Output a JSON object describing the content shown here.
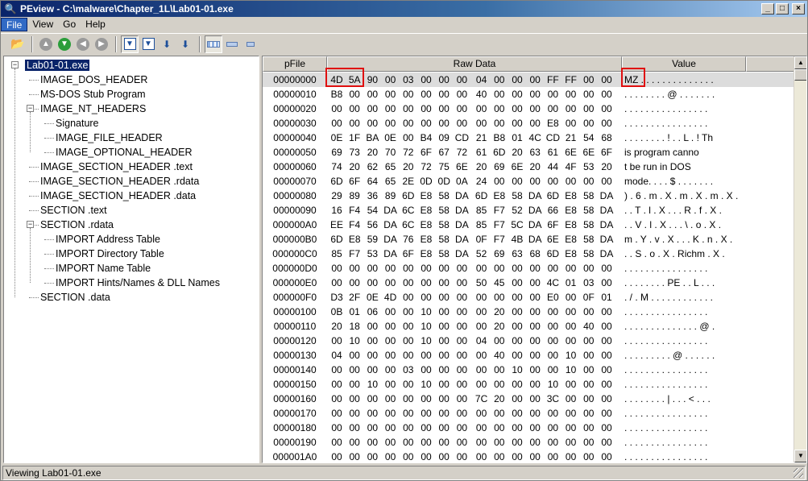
{
  "window": {
    "title": "PEview - C:\\malware\\Chapter_1L\\Lab01-01.exe",
    "app_icon": "magnifier-icon",
    "buttons": {
      "minimize": "_",
      "maximize": "□",
      "close": "×"
    }
  },
  "menu": [
    "File",
    "View",
    "Go",
    "Help"
  ],
  "toolbar": [
    "open-icon",
    "back-gray-icon",
    "forward-green-icon",
    "back-icon",
    "forward-icon",
    "header-icon",
    "section-icon",
    "prev-icon",
    "next-icon",
    "hex-view-icon",
    "dword-view-icon",
    "word-view-icon"
  ],
  "tree": [
    {
      "label": "Lab01-01.exe",
      "level": 0,
      "expander": "−",
      "selected": true
    },
    {
      "label": "IMAGE_DOS_HEADER",
      "level": 1
    },
    {
      "label": "MS-DOS Stub Program",
      "level": 1
    },
    {
      "label": "IMAGE_NT_HEADERS",
      "level": 1,
      "expander": "−"
    },
    {
      "label": "Signature",
      "level": 2
    },
    {
      "label": "IMAGE_FILE_HEADER",
      "level": 2
    },
    {
      "label": "IMAGE_OPTIONAL_HEADER",
      "level": 2
    },
    {
      "label": "IMAGE_SECTION_HEADER .text",
      "level": 1
    },
    {
      "label": "IMAGE_SECTION_HEADER .rdata",
      "level": 1
    },
    {
      "label": "IMAGE_SECTION_HEADER .data",
      "level": 1
    },
    {
      "label": "SECTION .text",
      "level": 1
    },
    {
      "label": "SECTION .rdata",
      "level": 1,
      "expander": "−"
    },
    {
      "label": "IMPORT Address Table",
      "level": 2
    },
    {
      "label": "IMPORT Directory Table",
      "level": 2
    },
    {
      "label": "IMPORT Name Table",
      "level": 2
    },
    {
      "label": "IMPORT Hints/Names & DLL Names",
      "level": 2
    },
    {
      "label": "SECTION .data",
      "level": 1
    }
  ],
  "hex": {
    "headers": {
      "offset": "pFile",
      "raw": "Raw Data",
      "value": "Value"
    },
    "rows": [
      {
        "off": "00000000",
        "bytes": [
          "4D",
          "5A",
          "90",
          "00",
          "03",
          "00",
          "00",
          "00",
          "04",
          "00",
          "00",
          "00",
          "FF",
          "FF",
          "00",
          "00"
        ],
        "val": "MZ . . . . . . . . . . . . . ."
      },
      {
        "off": "00000010",
        "bytes": [
          "B8",
          "00",
          "00",
          "00",
          "00",
          "00",
          "00",
          "00",
          "40",
          "00",
          "00",
          "00",
          "00",
          "00",
          "00",
          "00"
        ],
        "val": ". . . . . . . . @ . . . . . . ."
      },
      {
        "off": "00000020",
        "bytes": [
          "00",
          "00",
          "00",
          "00",
          "00",
          "00",
          "00",
          "00",
          "00",
          "00",
          "00",
          "00",
          "00",
          "00",
          "00",
          "00"
        ],
        "val": ". . . . . . . . . . . . . . . ."
      },
      {
        "off": "00000030",
        "bytes": [
          "00",
          "00",
          "00",
          "00",
          "00",
          "00",
          "00",
          "00",
          "00",
          "00",
          "00",
          "00",
          "E8",
          "00",
          "00",
          "00"
        ],
        "val": ". . . . . . . . . . . . . . . ."
      },
      {
        "off": "00000040",
        "bytes": [
          "0E",
          "1F",
          "BA",
          "0E",
          "00",
          "B4",
          "09",
          "CD",
          "21",
          "B8",
          "01",
          "4C",
          "CD",
          "21",
          "54",
          "68"
        ],
        "val": ". . . . . . . . ! . . L . ! Th"
      },
      {
        "off": "00000050",
        "bytes": [
          "69",
          "73",
          "20",
          "70",
          "72",
          "6F",
          "67",
          "72",
          "61",
          "6D",
          "20",
          "63",
          "61",
          "6E",
          "6E",
          "6F"
        ],
        "val": "is program canno"
      },
      {
        "off": "00000060",
        "bytes": [
          "74",
          "20",
          "62",
          "65",
          "20",
          "72",
          "75",
          "6E",
          "20",
          "69",
          "6E",
          "20",
          "44",
          "4F",
          "53",
          "20"
        ],
        "val": "t be run in DOS"
      },
      {
        "off": "00000070",
        "bytes": [
          "6D",
          "6F",
          "64",
          "65",
          "2E",
          "0D",
          "0D",
          "0A",
          "24",
          "00",
          "00",
          "00",
          "00",
          "00",
          "00",
          "00"
        ],
        "val": "mode. . . . $ . . . . . . ."
      },
      {
        "off": "00000080",
        "bytes": [
          "29",
          "89",
          "36",
          "89",
          "6D",
          "E8",
          "58",
          "DA",
          "6D",
          "E8",
          "58",
          "DA",
          "6D",
          "E8",
          "58",
          "DA"
        ],
        "val": ") . 6 . m . X . m . X . m . X ."
      },
      {
        "off": "00000090",
        "bytes": [
          "16",
          "F4",
          "54",
          "DA",
          "6C",
          "E8",
          "58",
          "DA",
          "85",
          "F7",
          "52",
          "DA",
          "66",
          "E8",
          "58",
          "DA"
        ],
        "val": ". . T . l . X . . . R . f . X ."
      },
      {
        "off": "000000A0",
        "bytes": [
          "EE",
          "F4",
          "56",
          "DA",
          "6C",
          "E8",
          "58",
          "DA",
          "85",
          "F7",
          "5C",
          "DA",
          "6F",
          "E8",
          "58",
          "DA"
        ],
        "val": ". . V . l . X . . . \\ . o . X ."
      },
      {
        "off": "000000B0",
        "bytes": [
          "6D",
          "E8",
          "59",
          "DA",
          "76",
          "E8",
          "58",
          "DA",
          "0F",
          "F7",
          "4B",
          "DA",
          "6E",
          "E8",
          "58",
          "DA"
        ],
        "val": "m . Y . v . X . . . K . n . X ."
      },
      {
        "off": "000000C0",
        "bytes": [
          "85",
          "F7",
          "53",
          "DA",
          "6F",
          "E8",
          "58",
          "DA",
          "52",
          "69",
          "63",
          "68",
          "6D",
          "E8",
          "58",
          "DA"
        ],
        "val": ". . S . o . X . Richm . X ."
      },
      {
        "off": "000000D0",
        "bytes": [
          "00",
          "00",
          "00",
          "00",
          "00",
          "00",
          "00",
          "00",
          "00",
          "00",
          "00",
          "00",
          "00",
          "00",
          "00",
          "00"
        ],
        "val": ". . . . . . . . . . . . . . . ."
      },
      {
        "off": "000000E0",
        "bytes": [
          "00",
          "00",
          "00",
          "00",
          "00",
          "00",
          "00",
          "00",
          "50",
          "45",
          "00",
          "00",
          "4C",
          "01",
          "03",
          "00"
        ],
        "val": ". . . . . . . . PE . . L . . ."
      },
      {
        "off": "000000F0",
        "bytes": [
          "D3",
          "2F",
          "0E",
          "4D",
          "00",
          "00",
          "00",
          "00",
          "00",
          "00",
          "00",
          "00",
          "E0",
          "00",
          "0F",
          "01"
        ],
        "val": ". / . M . . . . . . . . . . . ."
      },
      {
        "off": "00000100",
        "bytes": [
          "0B",
          "01",
          "06",
          "00",
          "00",
          "10",
          "00",
          "00",
          "00",
          "20",
          "00",
          "00",
          "00",
          "00",
          "00",
          "00"
        ],
        "val": ". . . . . . . . . . . . . . . ."
      },
      {
        "off": "00000110",
        "bytes": [
          "20",
          "18",
          "00",
          "00",
          "00",
          "10",
          "00",
          "00",
          "00",
          "20",
          "00",
          "00",
          "00",
          "00",
          "40",
          "00"
        ],
        "val": ". . . . . . . . . . . . . . @ ."
      },
      {
        "off": "00000120",
        "bytes": [
          "00",
          "10",
          "00",
          "00",
          "00",
          "10",
          "00",
          "00",
          "04",
          "00",
          "00",
          "00",
          "00",
          "00",
          "00",
          "00"
        ],
        "val": ". . . . . . . . . . . . . . . ."
      },
      {
        "off": "00000130",
        "bytes": [
          "04",
          "00",
          "00",
          "00",
          "00",
          "00",
          "00",
          "00",
          "00",
          "40",
          "00",
          "00",
          "00",
          "10",
          "00",
          "00"
        ],
        "val": ". . . . . . . . . @ . . . . . ."
      },
      {
        "off": "00000140",
        "bytes": [
          "00",
          "00",
          "00",
          "00",
          "03",
          "00",
          "00",
          "00",
          "00",
          "00",
          "10",
          "00",
          "00",
          "10",
          "00",
          "00"
        ],
        "val": ". . . . . . . . . . . . . . . ."
      },
      {
        "off": "00000150",
        "bytes": [
          "00",
          "00",
          "10",
          "00",
          "00",
          "10",
          "00",
          "00",
          "00",
          "00",
          "00",
          "00",
          "10",
          "00",
          "00",
          "00"
        ],
        "val": ". . . . . . . . . . . . . . . ."
      },
      {
        "off": "00000160",
        "bytes": [
          "00",
          "00",
          "00",
          "00",
          "00",
          "00",
          "00",
          "00",
          "7C",
          "20",
          "00",
          "00",
          "3C",
          "00",
          "00",
          "00"
        ],
        "val": ". . . . . . . . | . . . < . . ."
      },
      {
        "off": "00000170",
        "bytes": [
          "00",
          "00",
          "00",
          "00",
          "00",
          "00",
          "00",
          "00",
          "00",
          "00",
          "00",
          "00",
          "00",
          "00",
          "00",
          "00"
        ],
        "val": ". . . . . . . . . . . . . . . ."
      },
      {
        "off": "00000180",
        "bytes": [
          "00",
          "00",
          "00",
          "00",
          "00",
          "00",
          "00",
          "00",
          "00",
          "00",
          "00",
          "00",
          "00",
          "00",
          "00",
          "00"
        ],
        "val": ". . . . . . . . . . . . . . . ."
      },
      {
        "off": "00000190",
        "bytes": [
          "00",
          "00",
          "00",
          "00",
          "00",
          "00",
          "00",
          "00",
          "00",
          "00",
          "00",
          "00",
          "00",
          "00",
          "00",
          "00"
        ],
        "val": ". . . . . . . . . . . . . . . ."
      },
      {
        "off": "000001A0",
        "bytes": [
          "00",
          "00",
          "00",
          "00",
          "00",
          "00",
          "00",
          "00",
          "00",
          "00",
          "00",
          "00",
          "00",
          "00",
          "00",
          "00"
        ],
        "val": ". . . . . . . . . . . . . . . ."
      }
    ],
    "highlight_row": 0,
    "highlight_color": "#e01010"
  },
  "status": "Viewing Lab01-01.exe"
}
